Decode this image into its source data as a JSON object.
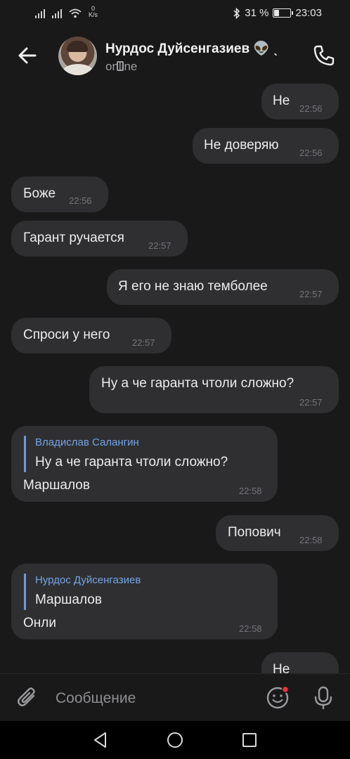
{
  "status_bar": {
    "net_speed_value": "0",
    "net_speed_unit": "K/s",
    "battery_percent_text": "31 %",
    "battery_level": 0.31,
    "time": "23:03"
  },
  "header": {
    "contact_name": "Нурдос Дуйсенгазиев 👽 ˎ",
    "status": "online",
    "icons": {
      "back": "back-arrow-icon",
      "call": "phone-call-icon",
      "online_device": "mobile-device-icon"
    }
  },
  "messages": [
    {
      "dir": "out",
      "text": "Не",
      "time": "22:56"
    },
    {
      "dir": "out",
      "text": "Не доверяю",
      "time": "22:56"
    },
    {
      "dir": "in",
      "text": "Боже",
      "time": "22:56"
    },
    {
      "dir": "in",
      "text": "Гарант ручается",
      "time": "22:57"
    },
    {
      "dir": "out",
      "text": "Я его не знаю темболее",
      "time": "22:57"
    },
    {
      "dir": "in",
      "text": "Спроси у него",
      "time": "22:57"
    },
    {
      "dir": "out",
      "text": "Ну а че гаранта чтоли сложно?",
      "time": "22:57"
    },
    {
      "dir": "in",
      "reply_name": "Владислав Салангин",
      "reply_text": "Ну а че гаранта чтоли сложно?",
      "text": "Маршалов",
      "time": "22:58"
    },
    {
      "dir": "out",
      "text": "Попович",
      "time": "22:58"
    },
    {
      "dir": "in",
      "reply_name": "Нурдос Дуйсенгазиев",
      "reply_text": "Маршалов",
      "text": "Онли",
      "time": "22:58"
    },
    {
      "dir": "out",
      "text": "Не",
      "time": ""
    }
  ],
  "composer": {
    "placeholder": "Сообщение",
    "icons": {
      "attach": "paperclip-icon",
      "emoji": "emoji-smile-icon",
      "mic": "microphone-icon"
    }
  },
  "colors": {
    "background": "#19191a",
    "bubble": "#2f2f31",
    "reply_accent": "#6f99d8",
    "emoji_badge": "#e8323c"
  }
}
